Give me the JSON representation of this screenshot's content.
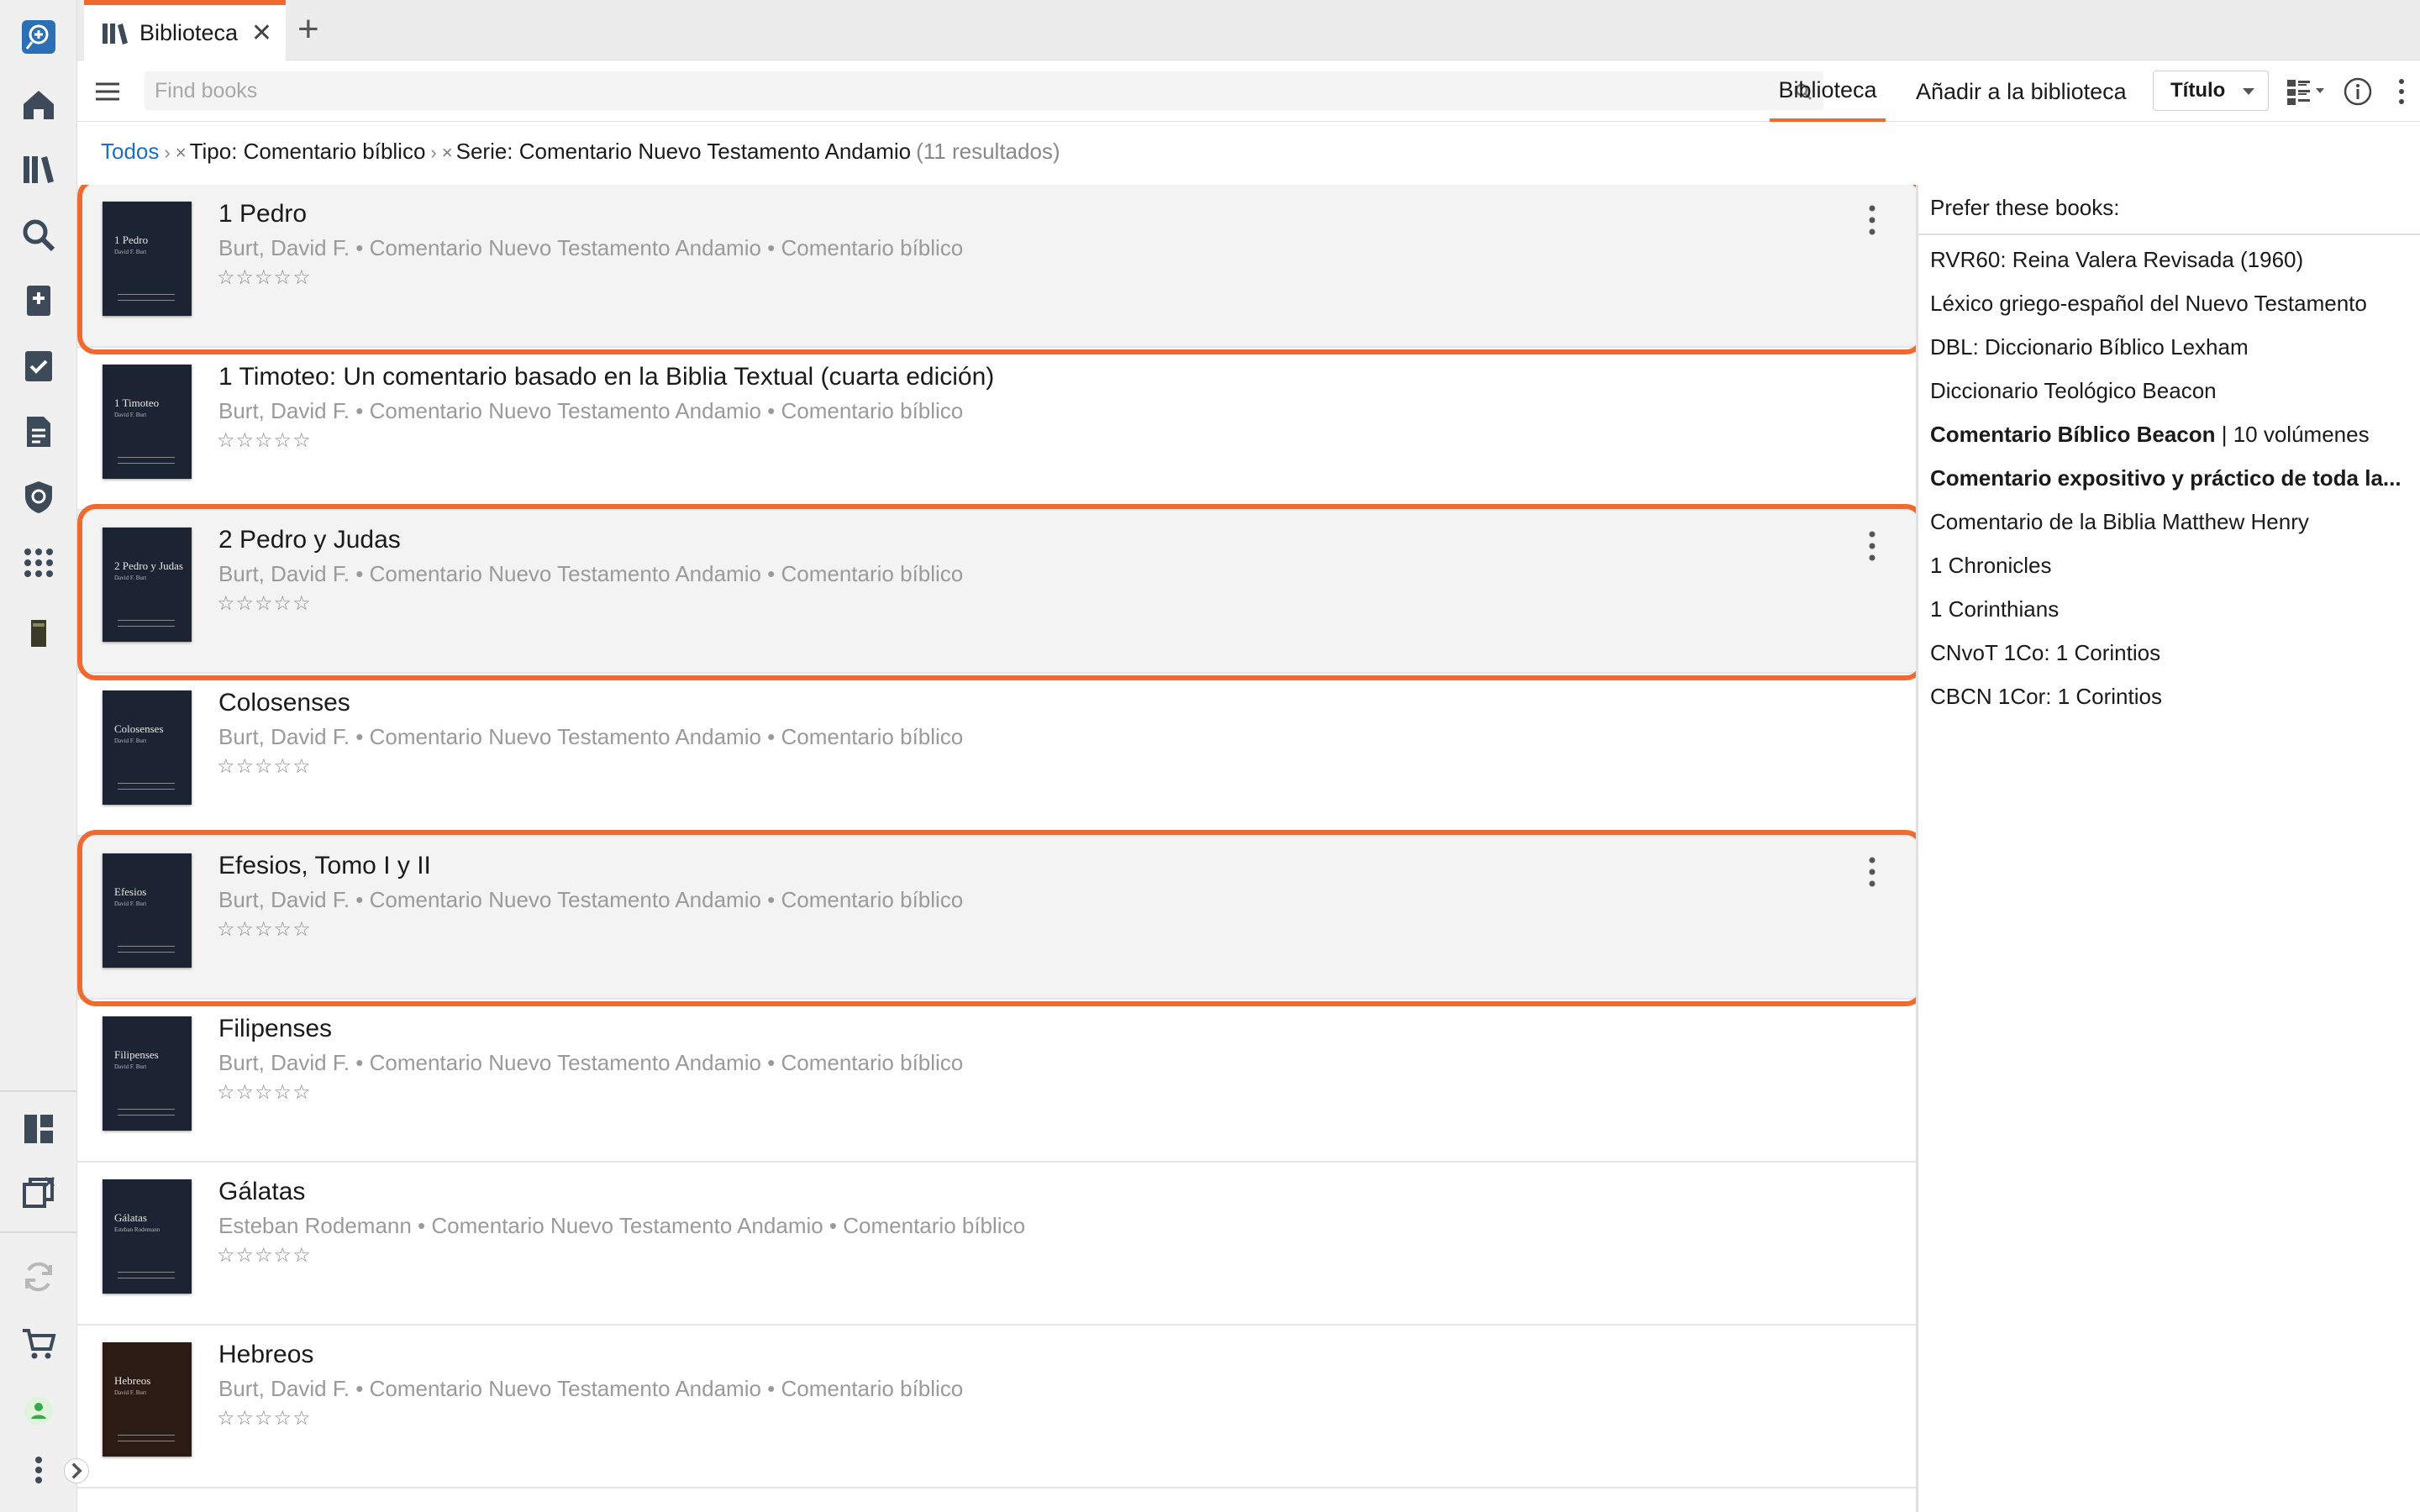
{
  "app": {
    "tab_label": "Biblioteca",
    "search_placeholder": "Find books",
    "accent_color": "#f0692e",
    "link_color": "#1e6fbf"
  },
  "toolbar": {
    "tab_library": "Biblioteca",
    "tab_add": "Añadir a la biblioteca",
    "sort_label": "Título"
  },
  "breadcrumb": {
    "root": "Todos",
    "filter1": "Tipo: Comentario bíblico",
    "filter2": "Serie: Comentario Nuevo Testamento Andamio",
    "count": "(11 resultados)"
  },
  "books": [
    {
      "title": "1 Pedro",
      "meta": "Burt, David F. • Comentario Nuevo Testamento Andamio • Comentario bíblico",
      "cover_title": "1 Pedro",
      "cover_author": "David F. Burt",
      "highlighted": true
    },
    {
      "title": "1 Timoteo: Un comentario basado en la Biblia Textual (cuarta edición)",
      "meta": "Burt, David F. • Comentario Nuevo Testamento Andamio • Comentario bíblico",
      "cover_title": "1 Timoteo",
      "cover_author": "David F. Burt",
      "highlighted": false
    },
    {
      "title": "2 Pedro y Judas",
      "meta": "Burt, David F. • Comentario Nuevo Testamento Andamio • Comentario bíblico",
      "cover_title": "2 Pedro y Judas",
      "cover_author": "David F. Burt",
      "highlighted": true
    },
    {
      "title": "Colosenses",
      "meta": "Burt, David F. • Comentario Nuevo Testamento Andamio • Comentario bíblico",
      "cover_title": "Colosenses",
      "cover_author": "David F. Burt",
      "highlighted": false
    },
    {
      "title": "Efesios, Tomo I y II",
      "meta": "Burt, David F. • Comentario Nuevo Testamento Andamio • Comentario bíblico",
      "cover_title": "Efesios",
      "cover_author": "David F. Burt",
      "highlighted": true
    },
    {
      "title": "Filipenses",
      "meta": "Burt, David F. • Comentario Nuevo Testamento Andamio • Comentario bíblico",
      "cover_title": "Filipenses",
      "cover_author": "David F. Burt",
      "highlighted": false
    },
    {
      "title": "Gálatas",
      "meta": "Esteban Rodemann • Comentario Nuevo Testamento Andamio • Comentario bíblico",
      "cover_title": "Gálatas",
      "cover_author": "Esteban Rodemann",
      "highlighted": false
    },
    {
      "title": "Hebreos",
      "meta": "Burt, David F. • Comentario Nuevo Testamento Andamio • Comentario bíblico",
      "cover_title": "Hebreos",
      "cover_author": "David F. Burt",
      "highlighted": false
    }
  ],
  "rating_stars": "☆☆☆☆☆",
  "preferred": {
    "heading": "Prefer these books:",
    "items": [
      {
        "name": "RVR60: Reina Valera Revisada (1960)",
        "suffix": ""
      },
      {
        "name": "Léxico griego-español del Nuevo Testamento",
        "suffix": ""
      },
      {
        "name": "DBL: Diccionario Bíblico Lexham",
        "suffix": ""
      },
      {
        "name": "Diccionario Teológico Beacon",
        "suffix": ""
      },
      {
        "name": "Comentario Bíblico Beacon",
        "suffix": " | 10 volúmenes",
        "bold": true
      },
      {
        "name": "Comentario expositivo y práctico de toda la...",
        "suffix": "",
        "bold": true
      },
      {
        "name": "Comentario de la Biblia Matthew Henry",
        "suffix": ""
      },
      {
        "name": "1 Chronicles",
        "suffix": ""
      },
      {
        "name": "1 Corinthians",
        "suffix": ""
      },
      {
        "name": "CNvoT 1Co: 1 Corintios",
        "suffix": ""
      },
      {
        "name": "CBCN 1Cor: 1 Corintios",
        "suffix": ""
      }
    ]
  }
}
